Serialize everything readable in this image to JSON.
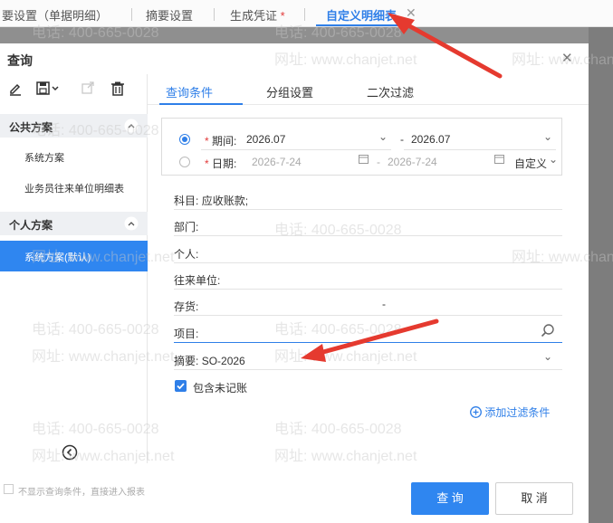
{
  "tabs": [
    {
      "label": "要设置（单据明细）"
    },
    {
      "label": "摘要设置"
    },
    {
      "label": "生成凭证",
      "required": "*"
    },
    {
      "label": "自定义明细表"
    }
  ],
  "dialog": {
    "title": "查询",
    "left": {
      "groups": [
        {
          "title": "公共方案",
          "items": [
            "系统方案",
            "业务员往来单位明细表"
          ]
        },
        {
          "title": "个人方案",
          "items": [
            "系统方案(默认)"
          ]
        }
      ]
    },
    "subtabs": [
      "查询条件",
      "分组设置",
      "二次过滤"
    ],
    "period": {
      "required": "*",
      "label": "期间:",
      "from": "2026.07",
      "dash": "-",
      "to": "2026.07"
    },
    "date": {
      "required": "*",
      "label": "日期:",
      "from": "2026-7-24",
      "dash": "-",
      "to": "2026-7-24",
      "mode": "自定义"
    },
    "fields": [
      {
        "label": "科目:",
        "value": "应收账款;"
      },
      {
        "label": "部门:",
        "value": ""
      },
      {
        "label": "个人:",
        "value": ""
      },
      {
        "label": "往来单位:",
        "value": ""
      },
      {
        "label": "存货:",
        "value": "-"
      },
      {
        "label": "项目:",
        "value": ""
      },
      {
        "label": "摘要:",
        "value": "SO-2026"
      }
    ],
    "include_unposted": "包含未记账",
    "add_filter": "添加过滤条件",
    "footer_hint": "不显示查询条件，直接进入报表",
    "query_button": "查 询",
    "cancel_button": "取 消"
  },
  "watermark": {
    "phone": "电话: 400-665-0028",
    "site": "网址: www.chanjet.net"
  },
  "colors": {
    "accent": "#2f86f0",
    "annotation_arrow": "#e53a2f"
  }
}
